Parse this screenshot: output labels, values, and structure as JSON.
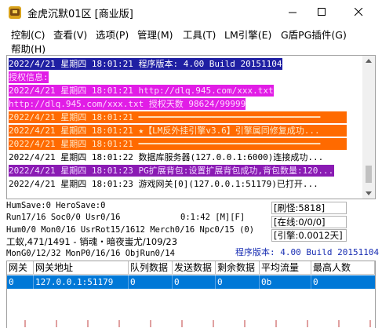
{
  "window": {
    "title": "金虎沉默01区 [商业版]"
  },
  "menu": [
    {
      "label": "控制(C)"
    },
    {
      "label": "查看(V)"
    },
    {
      "label": "选项(P)"
    },
    {
      "label": "管理(M)"
    },
    {
      "label": "工具(T)"
    },
    {
      "label": "LM引擎(E)"
    },
    {
      "label": "G盾PG插件(G)"
    },
    {
      "label": "帮助(H)"
    }
  ],
  "log": [
    {
      "text": "2022/4/21 星期四 18:01:21 程序版本: 4.00 Build 20151104",
      "style": "sel"
    },
    {
      "text": "授权信息:",
      "style": "mag"
    },
    {
      "text": "2022/4/21 星期四 18:01:21 http://dlq.945.com/xxx.txt",
      "style": "mag"
    },
    {
      "text": "http://dlq.945.com/xxx.txt 授权天数 98624/99999",
      "style": "mag"
    },
    {
      "text": "2022/4/21 星期四 18:01:21 ━━━━━━━━━━━━━━━━━━━━━━━━━━━━━━━━━━━",
      "style": "orange"
    },
    {
      "text": "2022/4/21 星期四 18:01:21 ★【LM反外挂引擎v3.6】引擎属同修复成功...",
      "style": "orange"
    },
    {
      "text": "2022/4/21 星期四 18:01:21 ━━━━━━━━━━━━━━━━━━━━━━━━━━━━━━━━━━━",
      "style": "orange"
    },
    {
      "text": "2022/4/21 星期四 18:01:22 数据库服务器(127.0.0.1:6000)连接成功...",
      "style": "plain"
    },
    {
      "text": "2022/4/21 星期四 18:01:23 PG扩展背包:设置扩展背包成功,背包数量:120...",
      "style": "purple"
    },
    {
      "text": "2022/4/21 星期四 18:01:23 游戏网关[0](127.0.0.1:51179)已打开...",
      "style": "plain"
    }
  ],
  "status": {
    "line1": "HumSave:0 HeroSave:0",
    "line2": "Run17/16 Soc0/0 Usr0/16",
    "time": "0:1:42 [M][F]",
    "line3": "Hum0/0 Mon0/16 UsrRot15/1612 Merch0/16 Npc0/15 (0)",
    "line4": "工蚁,471/1491 - 销魂・暗夜蚩尤/109/23",
    "line5": "MonG0/12/32 MonP0/16/16 ObjRun0/14",
    "refresh": "[刷怪:5818]",
    "online": "[在线:0/0/0]",
    "engine": "[引擎:0.0012天]",
    "version": "程序版本: 4.00 Build 20151104"
  },
  "table": {
    "headers": [
      "网关",
      "网关地址",
      "队列数据",
      "发送数据",
      "剩余数据",
      "平均流量",
      "最高人数"
    ],
    "rows": [
      [
        "0",
        "127.0.0.1:51179",
        "0",
        "0",
        "0",
        "0b",
        "0"
      ]
    ]
  }
}
